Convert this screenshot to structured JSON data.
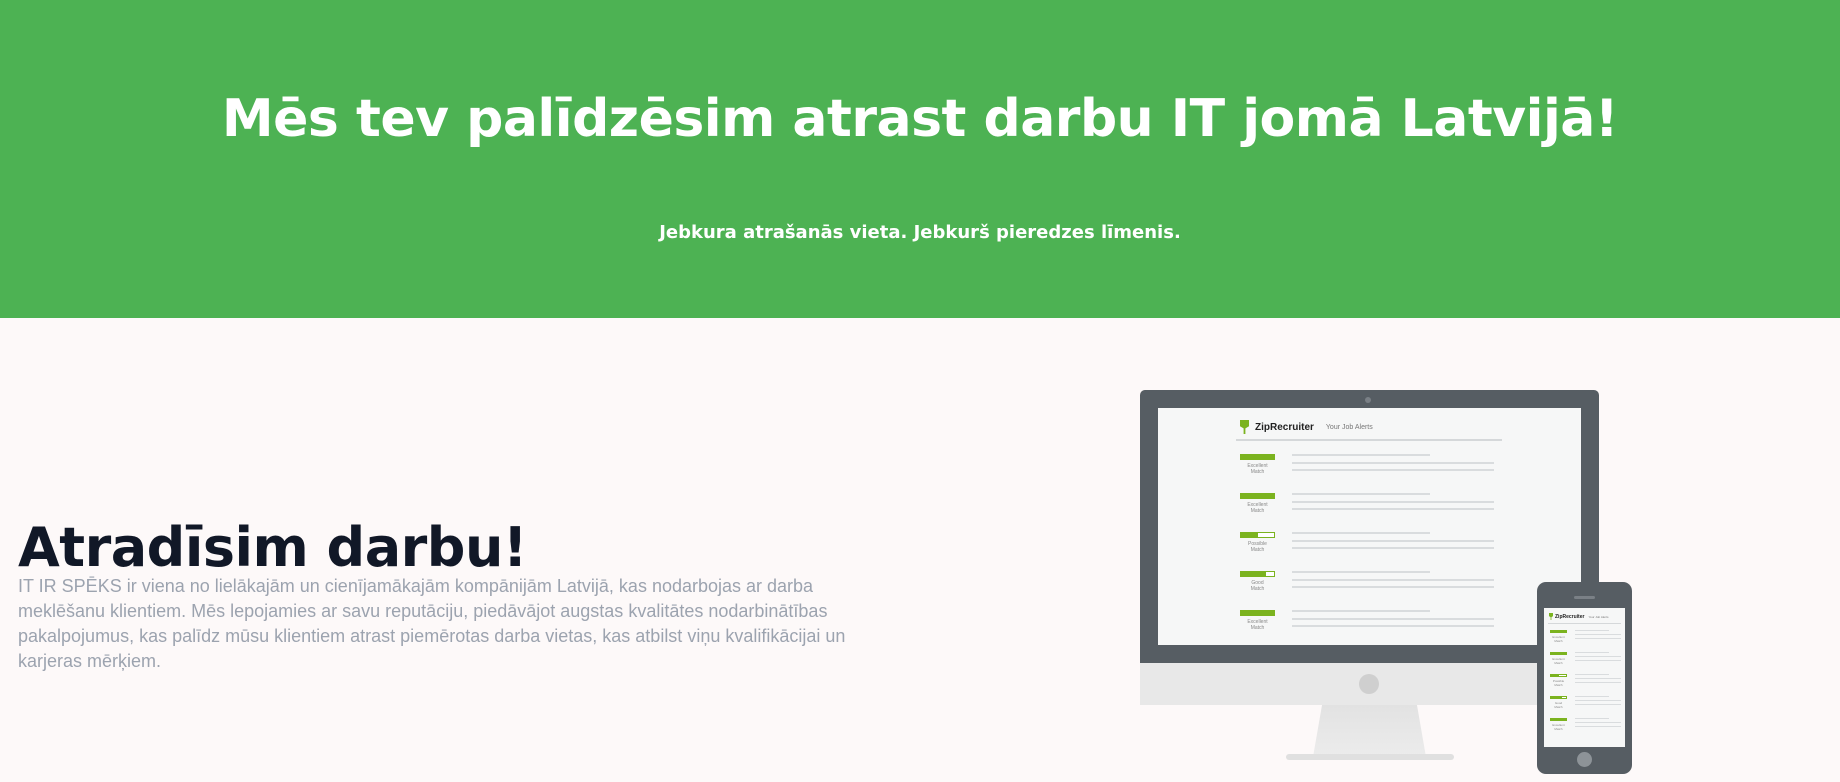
{
  "hero": {
    "title": "Mēs tev palīdzēsim atrast darbu IT jomā Latvijā!",
    "subtitle": "Jebkura atrašanās vieta. Jebkurš pieredzes līmenis."
  },
  "about": {
    "heading": "Atradīsim darbu!",
    "body": "IT IR SPĒKS ir viena no lielākajām un cienījamākajām kompānijām Latvijā, kas nodarbojas ar darba meklēšanu klientiem. Mēs lepojamies ar savu reputāciju, piedāvājot augstas kvalitātes nodarbinātības pakalpojumus, kas palīdz mūsu klientiem atrast piemērotas darba vietas, kas atbilst viņu kvalifikācijai un karjeras mērķiem."
  },
  "mockup": {
    "brand": "ZipRecruiter",
    "header_label": "Your Job Alerts",
    "accent_color": "#7bb31f",
    "alerts": [
      {
        "label_line1": "Excellent",
        "label_line2": "Match",
        "level": 1.0
      },
      {
        "label_line1": "Excellent",
        "label_line2": "Match",
        "level": 1.0
      },
      {
        "label_line1": "Possible",
        "label_line2": "Match",
        "level": 0.5
      },
      {
        "label_line1": "Good",
        "label_line2": "Match",
        "level": 0.75
      },
      {
        "label_line1": "Excellent",
        "label_line2": "Match",
        "level": 1.0
      }
    ]
  },
  "colors": {
    "hero_bg": "#4db253",
    "page_bg": "#fdf9f9",
    "heading": "#111827",
    "body_text": "#9ca3af",
    "device_frame": "#565d63"
  }
}
